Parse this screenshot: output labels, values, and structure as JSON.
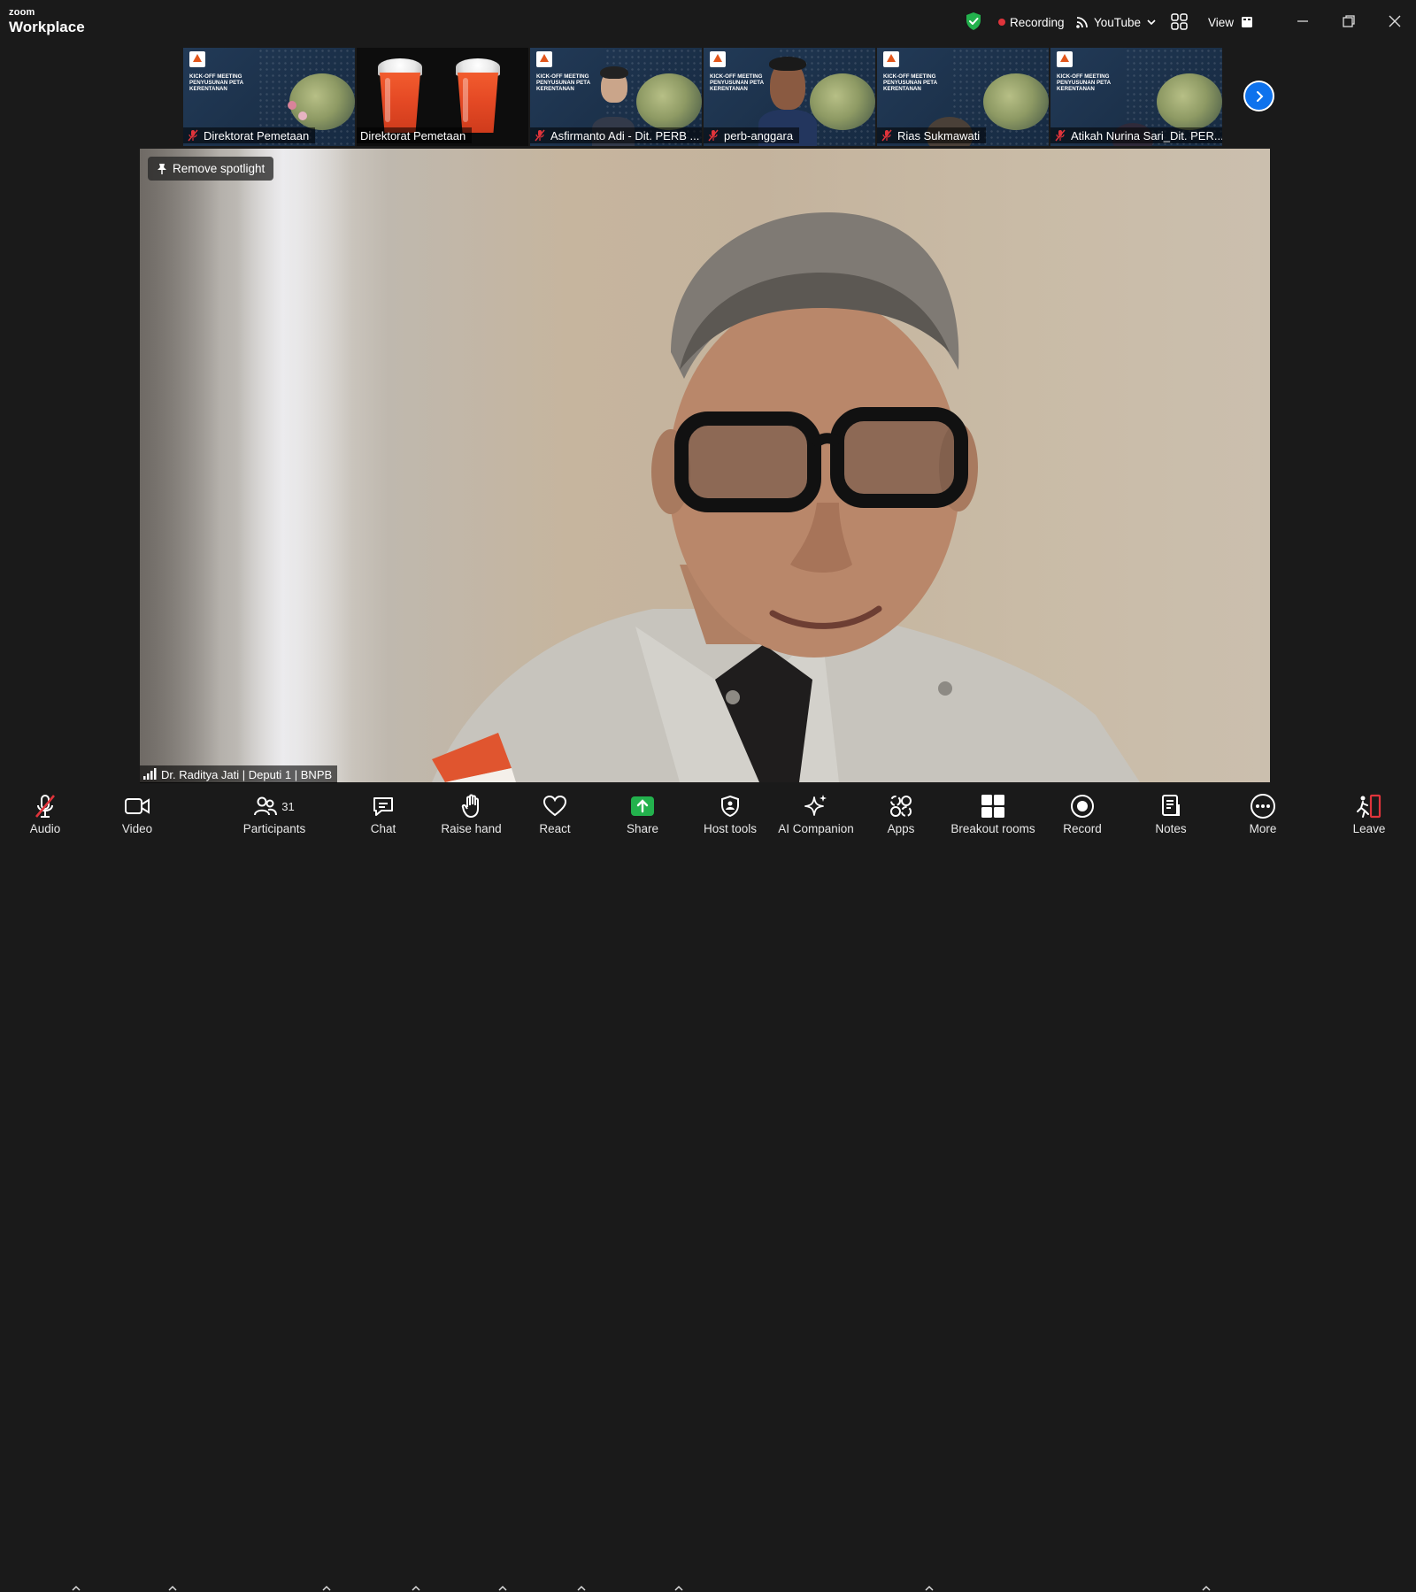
{
  "app": {
    "brand_small": "zoom",
    "brand_big": "Workplace"
  },
  "titlebar": {
    "recording_label": "Recording",
    "stream_label": "YouTube",
    "view_label": "View"
  },
  "thumbnails": [
    {
      "name": "Direktorat Pemetaan",
      "type": "slide",
      "muted": true,
      "slide_title": "KICK-OFF MEETING PENYUSUNAN PETA KERENTANAN"
    },
    {
      "name": "Direktorat Pemetaan",
      "type": "drinks",
      "muted": false
    },
    {
      "name": "Asfirmanto Adi - Dit. PERB ...",
      "type": "slide-person",
      "muted": true,
      "slide_title": "KICK-OFF MEETING PENYUSUNAN PETA KERENTANAN"
    },
    {
      "name": "perb-anggara",
      "type": "slide-person",
      "muted": true,
      "slide_title": "KICK-OFF MEETING PENYUSUNAN PETA KERENTANAN"
    },
    {
      "name": "Rias Sukmawati",
      "type": "slide-person",
      "muted": true,
      "slide_title": "KICK-OFF MEETING PENYUSUNAN PETA KERENTANAN"
    },
    {
      "name": "Atikah Nurina Sari_Dit. PER...",
      "type": "slide-person",
      "muted": true,
      "slide_title": "KICK-OFF MEETING PENYUSUNAN PETA KERENTANAN"
    }
  ],
  "main_video": {
    "spotlight_label": "Remove spotlight",
    "speaker_name": "Dr. Raditya Jati | Deputi 1 | BNPB"
  },
  "toolbar": {
    "audio": "Audio",
    "video": "Video",
    "participants": "Participants",
    "participants_count": "31",
    "chat": "Chat",
    "raise_hand": "Raise hand",
    "react": "React",
    "share": "Share",
    "host_tools": "Host tools",
    "ai_companion": "AI Companion",
    "apps": "Apps",
    "breakout_rooms": "Breakout rooms",
    "record": "Record",
    "notes": "Notes",
    "more": "More",
    "leave": "Leave"
  },
  "colors": {
    "accent": "#0e72ed",
    "share": "#23b14d",
    "muted": "#e0343b",
    "leave": "#e0343b",
    "shield": "#23b14d"
  }
}
